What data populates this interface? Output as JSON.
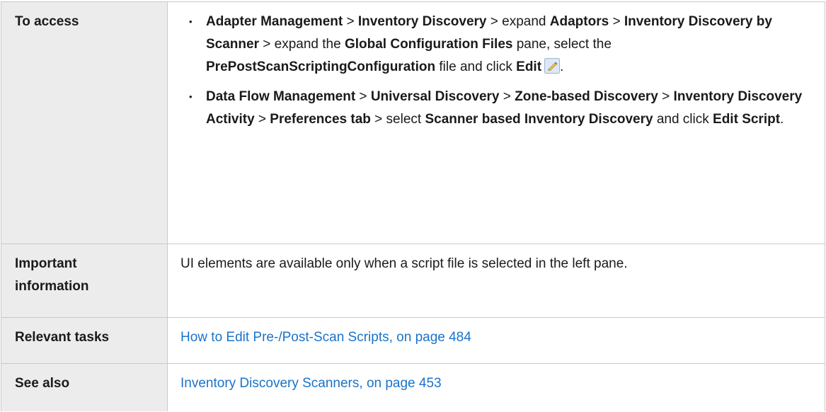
{
  "table": {
    "access": {
      "label": "To access",
      "items": [
        {
          "bullet": "•",
          "parts": [
            {
              "t": "Adapter Management",
              "b": true
            },
            {
              "t": " > ",
              "b": false
            },
            {
              "t": "Inventory Discovery",
              "b": true
            },
            {
              "t": " > expand ",
              "b": false
            },
            {
              "t": "Adaptors",
              "b": true
            },
            {
              "t": " > ",
              "b": false
            },
            {
              "t": "Inventory Discovery by Scanner",
              "b": true
            },
            {
              "t": " > expand the ",
              "b": false
            },
            {
              "t": "Global Configuration Files",
              "b": true
            },
            {
              "t": " pane, select the ",
              "b": false
            },
            {
              "t": "PrePostScanScriptingConfiguration",
              "b": true
            },
            {
              "t": " file and click ",
              "b": false
            },
            {
              "t": "Edit",
              "b": true
            },
            {
              "t": ".",
              "b": false
            }
          ]
        },
        {
          "bullet": "•",
          "parts": [
            {
              "t": "Data Flow Management",
              "b": true
            },
            {
              "t": " > ",
              "b": false
            },
            {
              "t": "Universal Discovery",
              "b": true
            },
            {
              "t": " > ",
              "b": false
            },
            {
              "t": "Zone-based Discovery",
              "b": true
            },
            {
              "t": " > ",
              "b": false
            },
            {
              "t": "Inventory Discovery Activity",
              "b": true
            },
            {
              "t": " > ",
              "b": false
            },
            {
              "t": "Preferences tab",
              "b": true
            },
            {
              "t": " > select ",
              "b": false
            },
            {
              "t": "Scanner based Inventory Discovery",
              "b": true
            },
            {
              "t": " and click ",
              "b": false
            },
            {
              "t": "Edit Script",
              "b": true
            },
            {
              "t": ".",
              "b": false
            }
          ]
        }
      ]
    },
    "important": {
      "label": "Important information",
      "text": "UI elements are available only when a script file is selected in the left pane."
    },
    "tasks": {
      "label": "Relevant tasks",
      "link": "How to Edit Pre-/Post-Scan Scripts, on page 484"
    },
    "see_also": {
      "label": "See also",
      "link": "Inventory Discovery Scanners, on page 453"
    }
  },
  "icons": {
    "edit": "pencil-edit-icon"
  },
  "colors": {
    "label_bg": "#ececec",
    "link": "#1a73c9",
    "border": "#c9c9c9"
  }
}
